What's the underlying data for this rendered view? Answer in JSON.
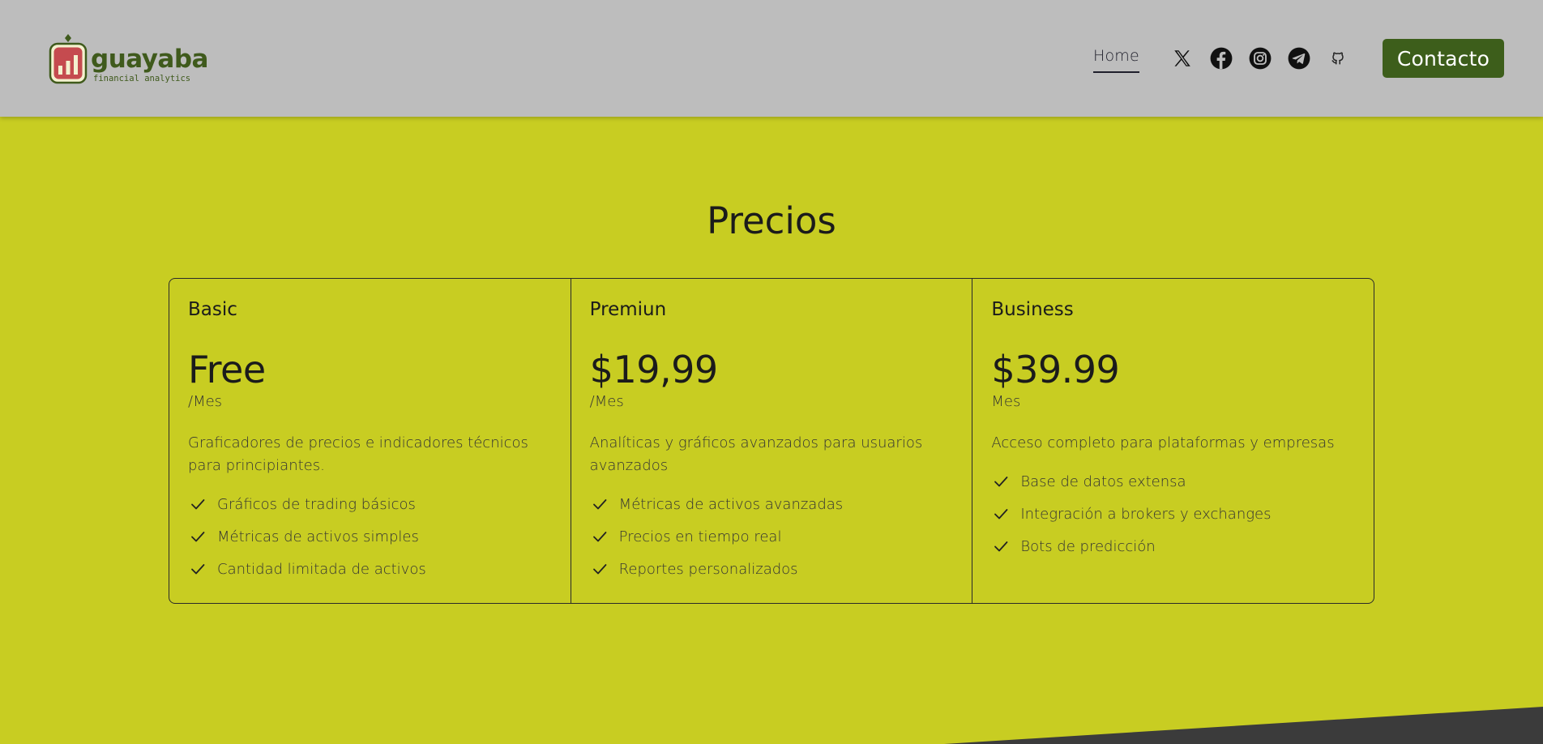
{
  "header": {
    "logo": {
      "name": "guayaba",
      "tagline": "financial analytics",
      "brand_color": "#3f5a1c",
      "mark_color": "#c54b4f"
    },
    "nav": {
      "home_label": "Home"
    },
    "social_icons": [
      "x-icon",
      "facebook-icon",
      "instagram-icon",
      "telegram-icon",
      "github-icon"
    ],
    "contact_label": "Contacto",
    "contact_color": "#3d5e1b",
    "background": "#bdbdbd"
  },
  "main": {
    "background": "#c8cd22",
    "title": "Precios",
    "plans": [
      {
        "name": "Basic",
        "price": "Free",
        "period": "/Mes",
        "description": "Graficadores de precios e indicadores técnicos para principiantes.",
        "features": [
          "Gráficos de trading básicos",
          "Métricas de activos simples",
          "Cantidad limitada de activos"
        ]
      },
      {
        "name": "Premiun",
        "price": "$19,99",
        "period": "/Mes",
        "description": "Analíticas y gráficos avanzados para usuarios avanzados",
        "features": [
          "Métricas de activos avanzadas",
          "Precios en tiempo real",
          "Reportes personalizados"
        ]
      },
      {
        "name": "Business",
        "price": "$39.99",
        "period": "Mes",
        "description": "Acceso completo para plataformas y empresas",
        "features": [
          "Base de datos extensa",
          "Integración a brokers y exchanges",
          "Bots de predicción"
        ]
      }
    ]
  },
  "footer_wedge_color": "#3b3b3b"
}
